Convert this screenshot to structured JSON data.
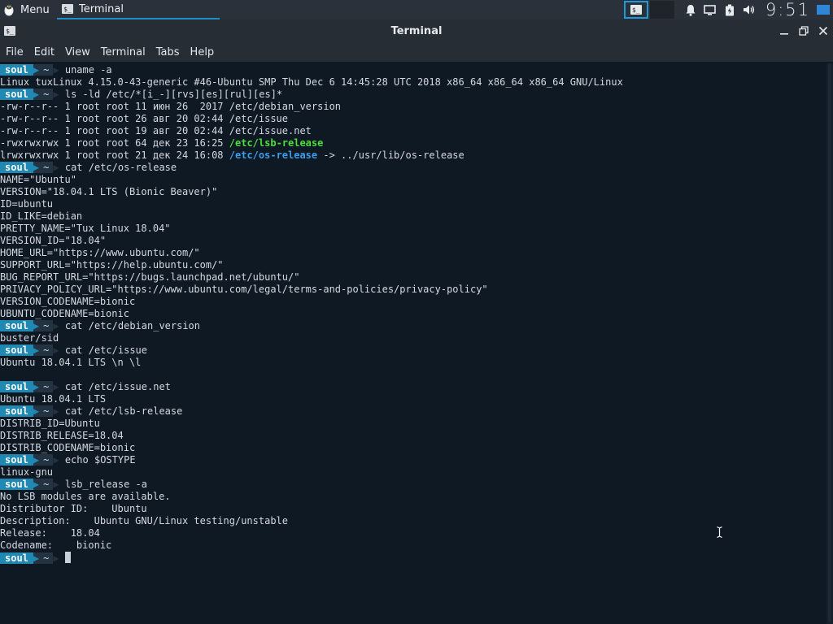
{
  "panel": {
    "menu_label": "Menu",
    "task_label": "Terminal",
    "clock": "9:51",
    "term_glyph": "$_"
  },
  "window": {
    "title": "Terminal"
  },
  "menubar": [
    "File",
    "Edit",
    "View",
    "Terminal",
    "Tabs",
    "Help"
  ],
  "prompt": {
    "user": "soul",
    "dir": "~"
  },
  "lines": [
    {
      "kind": "prompt",
      "cmd": "uname -a"
    },
    {
      "kind": "out",
      "text": "Linux tuxLinux 4.15.0-43-generic #46-Ubuntu SMP Thu Dec 6 14:45:28 UTC 2018 x86_64 x86_64 x86_64 GNU/Linux"
    },
    {
      "kind": "prompt",
      "cmd": "ls -ld /etc/*[i_-][rvs][es][rul][es]*"
    },
    {
      "kind": "out",
      "text": "-rw-r--r-- 1 root root 11 июн 26  2017 /etc/debian_version"
    },
    {
      "kind": "out",
      "text": "-rw-r--r-- 1 root root 26 авг 20 02:44 /etc/issue"
    },
    {
      "kind": "out",
      "text": "-rw-r--r-- 1 root root 19 авг 20 02:44 /etc/issue.net"
    },
    {
      "kind": "out",
      "text": "-rwxrwxrwx 1 root root 64 дек 23 16:25 ",
      "hl": "/etc/lsb-release",
      "hlclass": "green"
    },
    {
      "kind": "out",
      "text": "lrwxrwxrwx 1 root root 21 дек 24 16:08 ",
      "hl": "/etc/os-release",
      "hlclass": "cyan",
      "rest": " -> ../usr/lib/os-release"
    },
    {
      "kind": "prompt",
      "cmd": "cat /etc/os-release"
    },
    {
      "kind": "out",
      "text": "NAME=\"Ubuntu\""
    },
    {
      "kind": "out",
      "text": "VERSION=\"18.04.1 LTS (Bionic Beaver)\""
    },
    {
      "kind": "out",
      "text": "ID=ubuntu"
    },
    {
      "kind": "out",
      "text": "ID_LIKE=debian"
    },
    {
      "kind": "out",
      "text": "PRETTY_NAME=\"Tux Linux 18.04\""
    },
    {
      "kind": "out",
      "text": "VERSION_ID=\"18.04\""
    },
    {
      "kind": "out",
      "text": "HOME_URL=\"https://www.ubuntu.com/\""
    },
    {
      "kind": "out",
      "text": "SUPPORT_URL=\"https://help.ubuntu.com/\""
    },
    {
      "kind": "out",
      "text": "BUG_REPORT_URL=\"https://bugs.launchpad.net/ubuntu/\""
    },
    {
      "kind": "out",
      "text": "PRIVACY_POLICY_URL=\"https://www.ubuntu.com/legal/terms-and-policies/privacy-policy\""
    },
    {
      "kind": "out",
      "text": "VERSION_CODENAME=bionic"
    },
    {
      "kind": "out",
      "text": "UBUNTU_CODENAME=bionic"
    },
    {
      "kind": "prompt",
      "cmd": "cat /etc/debian_version"
    },
    {
      "kind": "out",
      "text": "buster/sid"
    },
    {
      "kind": "prompt",
      "cmd": "cat /etc/issue"
    },
    {
      "kind": "out",
      "text": "Ubuntu 18.04.1 LTS \\n \\l"
    },
    {
      "kind": "out",
      "text": ""
    },
    {
      "kind": "prompt",
      "cmd": "cat /etc/issue.net"
    },
    {
      "kind": "out",
      "text": "Ubuntu 18.04.1 LTS"
    },
    {
      "kind": "prompt",
      "cmd": "cat /etc/lsb-release"
    },
    {
      "kind": "out",
      "text": "DISTRIB_ID=Ubuntu"
    },
    {
      "kind": "out",
      "text": "DISTRIB_RELEASE=18.04"
    },
    {
      "kind": "out",
      "text": "DISTRIB_CODENAME=bionic"
    },
    {
      "kind": "prompt",
      "cmd": "echo $OSTYPE"
    },
    {
      "kind": "out",
      "text": "linux-gnu"
    },
    {
      "kind": "prompt",
      "cmd": "lsb_release -a"
    },
    {
      "kind": "out",
      "text": "No LSB modules are available."
    },
    {
      "kind": "out",
      "text": "Distributor ID:\tUbuntu"
    },
    {
      "kind": "out",
      "text": "Description:\tUbuntu GNU/Linux testing/unstable"
    },
    {
      "kind": "out",
      "text": "Release:\t18.04"
    },
    {
      "kind": "out",
      "text": "Codename:\tbionic"
    },
    {
      "kind": "prompt",
      "cmd": "",
      "cursor": true
    }
  ],
  "colors": {
    "accent": "#1f88b3",
    "background": "#0f1924",
    "exec_file": "#4cdc3c",
    "symlink": "#3d9de8"
  }
}
